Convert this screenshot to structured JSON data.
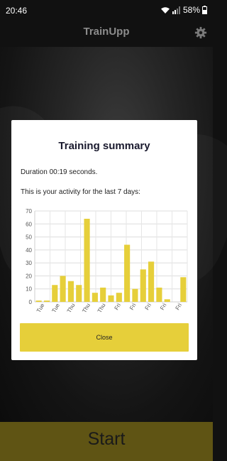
{
  "status_bar": {
    "time": "20:46",
    "battery": "58%"
  },
  "app_bar": {
    "title": "TrainUpp"
  },
  "dialog": {
    "title": "Training summary",
    "duration_text": "Duration 00:19 seconds.",
    "activity_text": "This is your activity for the last 7 days:",
    "close_label": "Close"
  },
  "start_label": "Start",
  "colors": {
    "accent": "#e6cf3a",
    "start_bar": "#5f5414"
  },
  "chart_data": {
    "type": "bar",
    "categories": [
      "Tue",
      "Tue",
      "Tue",
      "Tue",
      "Thu",
      "Thu",
      "Thu",
      "Thu",
      "Thu",
      "Thu",
      "Thu",
      "Fri",
      "Fri",
      "Fri",
      "Fri",
      "Fri",
      "Fri",
      "Fri",
      "Fri",
      "Fri"
    ],
    "tick_labels": [
      "Tue",
      "Tue",
      "Thu",
      "Thu",
      "Thu",
      "Fri",
      "Fri",
      "Fri",
      "Fri",
      "Fri"
    ],
    "values": [
      1,
      1,
      13,
      20,
      16,
      13,
      64,
      7,
      11,
      5,
      7,
      44,
      10,
      25,
      31,
      11,
      2,
      0,
      19
    ],
    "ylim": [
      0,
      70
    ],
    "yticks": [
      0,
      10,
      20,
      30,
      40,
      50,
      60,
      70
    ],
    "grid": true,
    "bar_color": "#e6cf3a"
  }
}
